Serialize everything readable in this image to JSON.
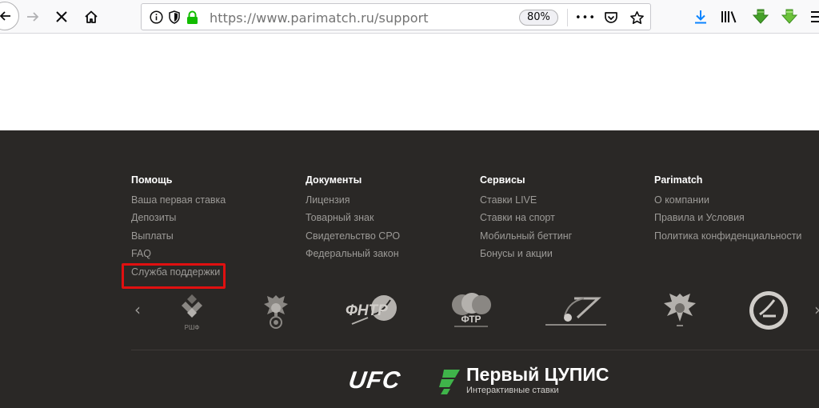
{
  "browser": {
    "url_scheme": "https://",
    "url_host": "www.parimatch.ru",
    "url_path": "/support",
    "zoom_label": "80%",
    "more_label": "•••"
  },
  "footer": {
    "columns": [
      {
        "title": "Помощь",
        "links": [
          "Ваша первая ставка",
          "Депозиты",
          "Выплаты",
          "FAQ",
          "Служба поддержки"
        ]
      },
      {
        "title": "Документы",
        "links": [
          "Лицензия",
          "Товарный знак",
          "Свидетельство СРО",
          "Федеральный закон"
        ]
      },
      {
        "title": "Сервисы",
        "links": [
          "Ставки LIVE",
          "Ставки на спорт",
          "Мобильный беттинг",
          "Бонусы и акции"
        ]
      },
      {
        "title": "Parimatch",
        "links": [
          "О компании",
          "Правила и Условия",
          "Политика конфиденциальности"
        ]
      }
    ],
    "partner_logos": {
      "ftr_text": "ФТР",
      "fhtr_text": "ФНТР",
      "rhf_text": "РШФ"
    },
    "sponsors": {
      "ufc": "UFC",
      "cupis_name": "Первый ЦУПИС",
      "cupis_tagline": "Интерактивные ставки"
    },
    "carousel_prev": "‹",
    "carousel_next": "›"
  },
  "colors": {
    "footer_bg": "#2a2826",
    "link": "#9c9a97",
    "highlight": "#e01010",
    "cupis_green": "#3fb44a",
    "firefox_blue": "#0a84ff",
    "lock_green": "#12bc00",
    "arrow_green": "#45a029"
  }
}
